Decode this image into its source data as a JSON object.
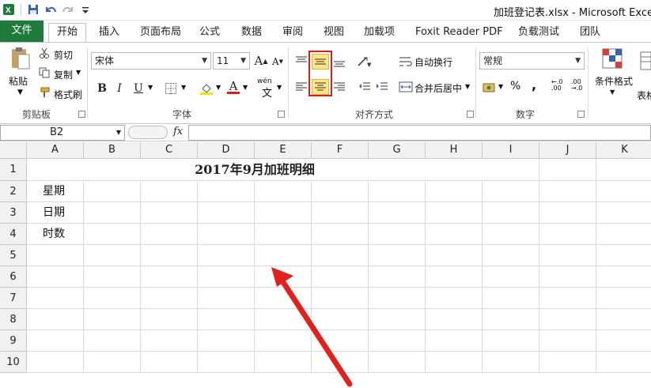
{
  "window": {
    "title": "加班登记表.xlsx - Microsoft Excel"
  },
  "quick_access": {
    "icons": [
      "excel-logo-icon",
      "save-icon",
      "undo-icon",
      "redo-icon",
      "customize-icon"
    ]
  },
  "tabs": [
    {
      "label": "文件"
    },
    {
      "label": "开始"
    },
    {
      "label": "插入"
    },
    {
      "label": "页面布局"
    },
    {
      "label": "公式"
    },
    {
      "label": "数据"
    },
    {
      "label": "审阅"
    },
    {
      "label": "视图"
    },
    {
      "label": "加载项"
    },
    {
      "label": "Foxit Reader PDF"
    },
    {
      "label": "负载测试"
    },
    {
      "label": "团队"
    }
  ],
  "ribbon": {
    "clipboard": {
      "paste": "粘贴",
      "cut": "剪切",
      "copy": "复制",
      "format_painter": "格式刷",
      "label": "剪贴板"
    },
    "font": {
      "name": "宋体",
      "size": "11",
      "label": "字体",
      "bold": "B",
      "italic": "I",
      "underline": "U",
      "grow": "A",
      "shrink": "A",
      "font_color": "A",
      "phonetic": "wén"
    },
    "alignment": {
      "wrap_text": "自动换行",
      "merge_center": "合并后居中",
      "label": "对齐方式"
    },
    "number": {
      "format": "常规",
      "percent": "%",
      "comma": ",",
      "label": "数字"
    },
    "styles": {
      "conditional": "条件格式",
      "table": "表格"
    }
  },
  "formula_bar": {
    "name_box": "B2",
    "fx": "fx",
    "value": ""
  },
  "sheet": {
    "columns": [
      "A",
      "B",
      "C",
      "D",
      "E",
      "F",
      "G",
      "H",
      "I",
      "J",
      "K"
    ],
    "rows": [
      "1",
      "2",
      "3",
      "4",
      "5",
      "6",
      "7",
      "8",
      "9",
      "10"
    ],
    "title": "2017年9月加班明细",
    "cells": {
      "A2": "星期",
      "A3": "日期",
      "A4": "时数"
    }
  },
  "colors": {
    "file_tab": "#1e7b3c",
    "highlight": "#fde58a",
    "annotation": "#d21f1f"
  }
}
